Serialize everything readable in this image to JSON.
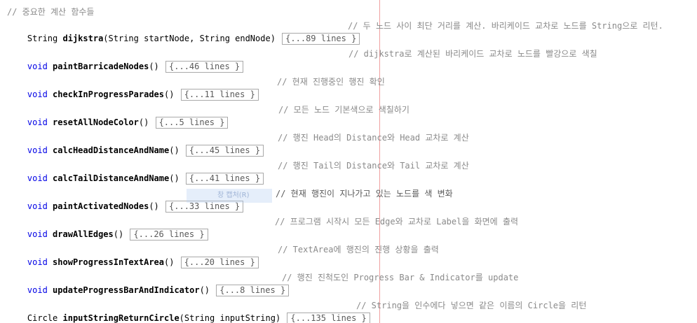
{
  "header_comment": "// 중요한 계산 함수들",
  "methods": [
    {
      "ret": "String",
      "name": "dijkstra",
      "params": "(String startNode, String endNode)",
      "fold": "{...89 lines }",
      "comment": "// 두 노드 사이 최단 거리를 계산. 바리케이드 교차로 노드를 String으로 리턴."
    },
    {
      "ret": "void",
      "name": "paintBarricadeNodes",
      "params": "()",
      "fold": "{...46 lines }",
      "comment": "// dijkstra로 계산된 바리케이드 교차로 노드를 빨강으로 색칠"
    },
    {
      "ret": "void",
      "name": "checkInProgressParades",
      "params": "()",
      "fold": "{...11 lines }",
      "comment": "// 현재 진행중인 행진 확인"
    },
    {
      "ret": "void",
      "name": "resetAllNodeColor",
      "params": "()",
      "fold": "{...5 lines }",
      "comment": "// 모든 노드 기본색으로 색칠하기"
    },
    {
      "ret": "void",
      "name": "calcHeadDistanceAndName",
      "params": "()",
      "fold": "{...45 lines }",
      "comment": "// 행진 Head의 Distance와 Head 교차로 계산"
    },
    {
      "ret": "void",
      "name": "calcTailDistanceAndName",
      "params": "()",
      "fold": "{...41 lines }",
      "comment": "// 행진 Tail의 Distance와 Tail 교차로 계산"
    },
    {
      "ret": "void",
      "name": "paintActivatedNodes",
      "params": "()",
      "fold": "{...33 lines }",
      "comment": "// 현재 행진이 지나가고 있는 노드를 색 변화"
    },
    {
      "ret": "void",
      "name": "drawAllEdges",
      "params": "()",
      "fold": "{...26 lines }",
      "comment": "// 프로그램 시작시 모든 Edge와 교차로 Label을 화면에 출력"
    },
    {
      "ret": "void",
      "name": "showProgressInTextArea",
      "params": "()",
      "fold": "{...20 lines }",
      "comment": "// TextArea에 행진의 진행 상황을 출력"
    },
    {
      "ret": "void",
      "name": "updateProgressBarAndIndicator",
      "params": "()",
      "fold": "{...8 lines }",
      "comment": "// 행진 진척도인 Progress Bar & Indicator를 update"
    },
    {
      "ret": "Circle",
      "name": "inputStringReturnCircle",
      "params": "(String inputString)",
      "fold": "{...135 lines }",
      "comment": "// String을 인수에다 넣으면 같은 이름의 Circle을 리턴"
    }
  ],
  "tooltip_ghost": "창 캡처(R)",
  "colors": {
    "keyword": "#0000e6",
    "comment": "#8a8a8a",
    "margin_line": "#f0a0a0",
    "fold_border": "#a9a9a9"
  }
}
